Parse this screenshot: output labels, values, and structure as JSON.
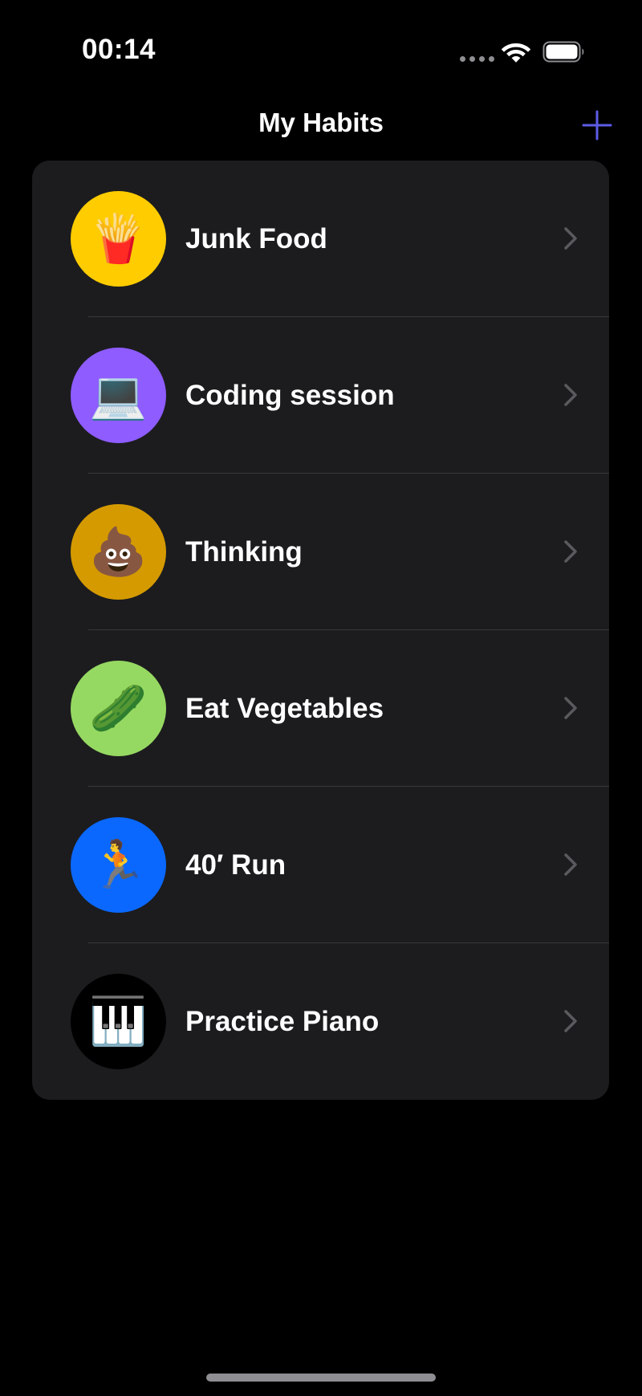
{
  "status_bar": {
    "time": "00:14"
  },
  "nav": {
    "title": "My Habits",
    "add_icon": "plus-icon"
  },
  "colors": {
    "accent": "#5e5ce6",
    "card_background": "#1c1c1e",
    "separator": "#38383a",
    "chevron": "#5a5a5e"
  },
  "habits": [
    {
      "label": "Junk Food",
      "emoji": "🍟",
      "color": "#ffcc00"
    },
    {
      "label": "Coding session",
      "emoji": "💻",
      "color": "#8e5cff"
    },
    {
      "label": "Thinking",
      "emoji": "💩",
      "color": "#d49a00"
    },
    {
      "label": "Eat Vegetables",
      "emoji": "🥒",
      "color": "#96d962"
    },
    {
      "label": "40′ Run",
      "emoji": "🏃",
      "color": "#0a68ff"
    },
    {
      "label": "Practice Piano",
      "emoji": "🎹",
      "color": "#000000"
    }
  ]
}
